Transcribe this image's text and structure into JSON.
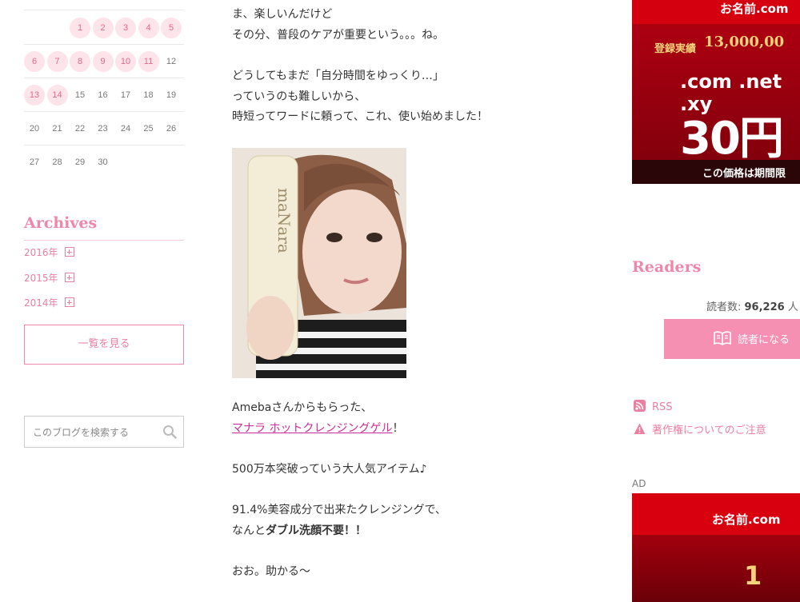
{
  "calendar": {
    "rows": [
      [
        {
          "d": "1",
          "hl": true
        },
        {
          "d": "2",
          "hl": true
        },
        {
          "d": "3",
          "hl": true
        },
        {
          "d": "4",
          "hl": true
        },
        {
          "d": "5",
          "hl": true
        }
      ],
      [
        {
          "d": "6",
          "hl": true
        },
        {
          "d": "7",
          "hl": true
        },
        {
          "d": "8",
          "hl": true
        },
        {
          "d": "9",
          "hl": true
        },
        {
          "d": "10",
          "hl": true
        },
        {
          "d": "11",
          "hl": true
        },
        {
          "d": "12",
          "hl": false
        }
      ],
      [
        {
          "d": "13",
          "hl": true
        },
        {
          "d": "14",
          "hl": true
        },
        {
          "d": "15",
          "hl": false
        },
        {
          "d": "16",
          "hl": false
        },
        {
          "d": "17",
          "hl": false
        },
        {
          "d": "18",
          "hl": false
        },
        {
          "d": "19",
          "hl": false
        }
      ],
      [
        {
          "d": "20",
          "hl": false
        },
        {
          "d": "21",
          "hl": false
        },
        {
          "d": "22",
          "hl": false
        },
        {
          "d": "23",
          "hl": false
        },
        {
          "d": "24",
          "hl": false
        },
        {
          "d": "25",
          "hl": false
        },
        {
          "d": "26",
          "hl": false
        }
      ],
      [
        {
          "d": "27",
          "hl": false
        },
        {
          "d": "28",
          "hl": false
        },
        {
          "d": "29",
          "hl": false
        },
        {
          "d": "30",
          "hl": false
        }
      ]
    ]
  },
  "archives": {
    "title": "Archives",
    "items": [
      "2016年",
      "2015年",
      "2014年"
    ],
    "list_button": "一覧を見る"
  },
  "search": {
    "placeholder": "このブログを検索する"
  },
  "post": {
    "lines": {
      "l1": "ま、楽しいんだけど",
      "l2": "その分、普段のケアが重要という。。。ね。",
      "l3": "どうしてもまだ「自分時間をゆっくり…」",
      "l4": "っていうのも難しいから、",
      "l5": "時短ってワードに頼って、これ、使い始めました！",
      "l6": "Amebaさんからもらった、",
      "link": "マナラ ホットクレンジングゲル",
      "link_suffix": "！",
      "l7": "500万本突破っていう大人気アイテム♪",
      "l8": "91.4%美容成分で出来たクレンジングで、",
      "l9a": "なんと",
      "l9b": "ダブル洗顔不要！！",
      "l10": "おお。助かる〜"
    },
    "photo_brand": "maNara"
  },
  "sidebar": {
    "ad_top": {
      "brand": "お名前.com",
      "record": "登録実績",
      "count": "13,000,00",
      "domains": ".com .net .xy",
      "price": "30円",
      "note": "この価格は期間限"
    },
    "readers": {
      "title": "Readers",
      "count_label": "読者数: ",
      "count_value": "96,226",
      "count_unit": " 人",
      "button": "読者になる"
    },
    "rss": "RSS",
    "copyright": "著作権についてのご注意",
    "ad_label": "AD",
    "ad_bottom": {
      "brand": "お名前.com",
      "big": "1"
    }
  },
  "colors": {
    "accent": "#ee87a8",
    "link": "#cc2b9b",
    "button": "#f590b2"
  }
}
